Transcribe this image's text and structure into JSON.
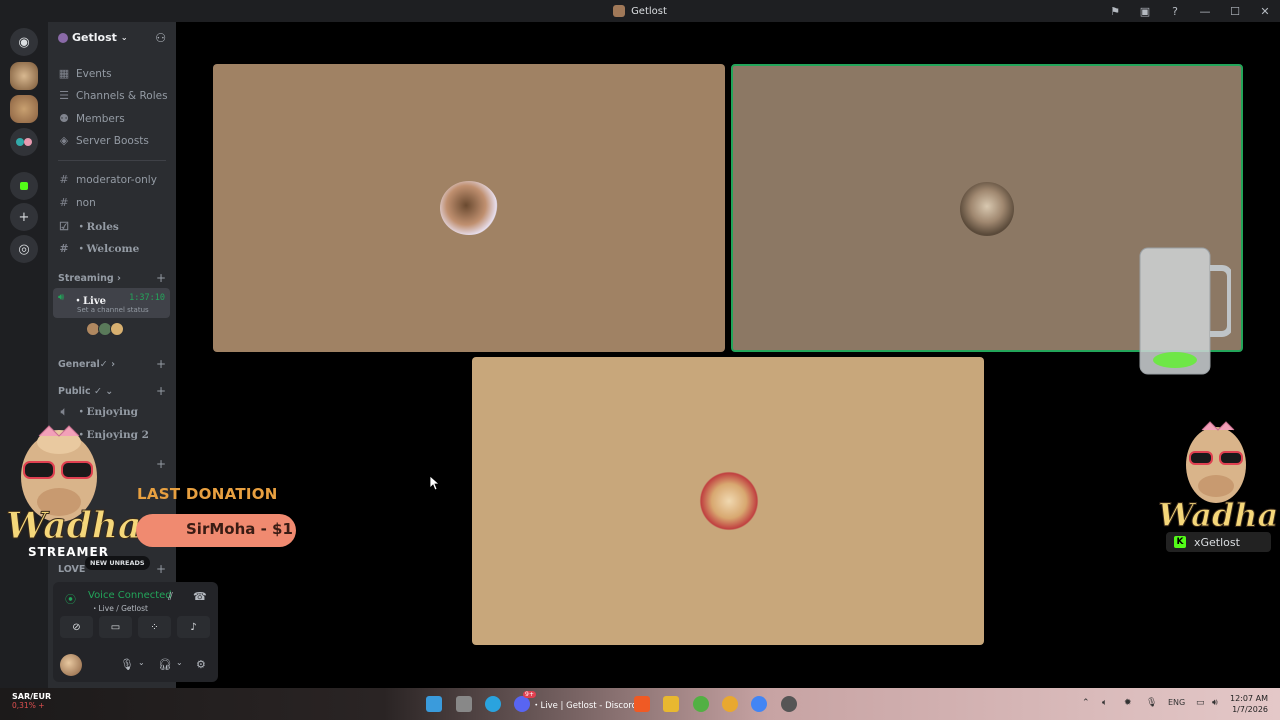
{
  "window": {
    "title": "Getlost",
    "controls": [
      "flag-icon",
      "inbox-icon",
      "help-icon",
      "minimize-icon",
      "maximize-icon",
      "close-icon"
    ]
  },
  "server": {
    "name": "Getlost",
    "menu": [
      {
        "label": "Events",
        "icon": "calendar-icon"
      },
      {
        "label": "Channels & Roles",
        "icon": "list-icon"
      },
      {
        "label": "Members",
        "icon": "members-icon"
      },
      {
        "label": "Server Boosts",
        "icon": "boost-icon"
      }
    ],
    "channels": [
      {
        "label": "moderator-only",
        "icon": "hash-icon"
      },
      {
        "label": "non",
        "icon": "hash-icon"
      },
      {
        "label": "・Roles",
        "icon": "checkbox-icon"
      },
      {
        "label": "・Welcome",
        "icon": "hash-icon"
      }
    ],
    "categories": {
      "streaming": "Streaming",
      "general": "General✓",
      "public": "Public ✓",
      "love": "LOVE"
    },
    "live_channel": {
      "name": "・Live",
      "duration": "1:37:10",
      "status": "Set a channel status"
    },
    "voice_channels": [
      {
        "label": "・Enjoying"
      },
      {
        "label": "・Enjoying 2"
      }
    ],
    "new_unreads": "NEW UNREADS"
  },
  "voice_panel": {
    "status": "Voice Connected",
    "location": "・Live / Getlost"
  },
  "overlay": {
    "last_donation_label": "LAST DONATION",
    "last_donation_value": "SirMoha - $1",
    "streamer_brand": "Wadha",
    "streamer_label": "STREAMER",
    "kick_handle": "xGetlost"
  },
  "taskbar": {
    "currency_pair": "SAR/EUR",
    "currency_change": "0,31% +",
    "discord_label": "・Live | Getlost - Discord",
    "language": "ENG",
    "time": "12:07 AM",
    "date": "1/7/2026",
    "discord_badge": "9+"
  },
  "colors": {
    "green": "#23a55a",
    "rail": "#1e1f22",
    "sidebar": "#2b2d31"
  }
}
